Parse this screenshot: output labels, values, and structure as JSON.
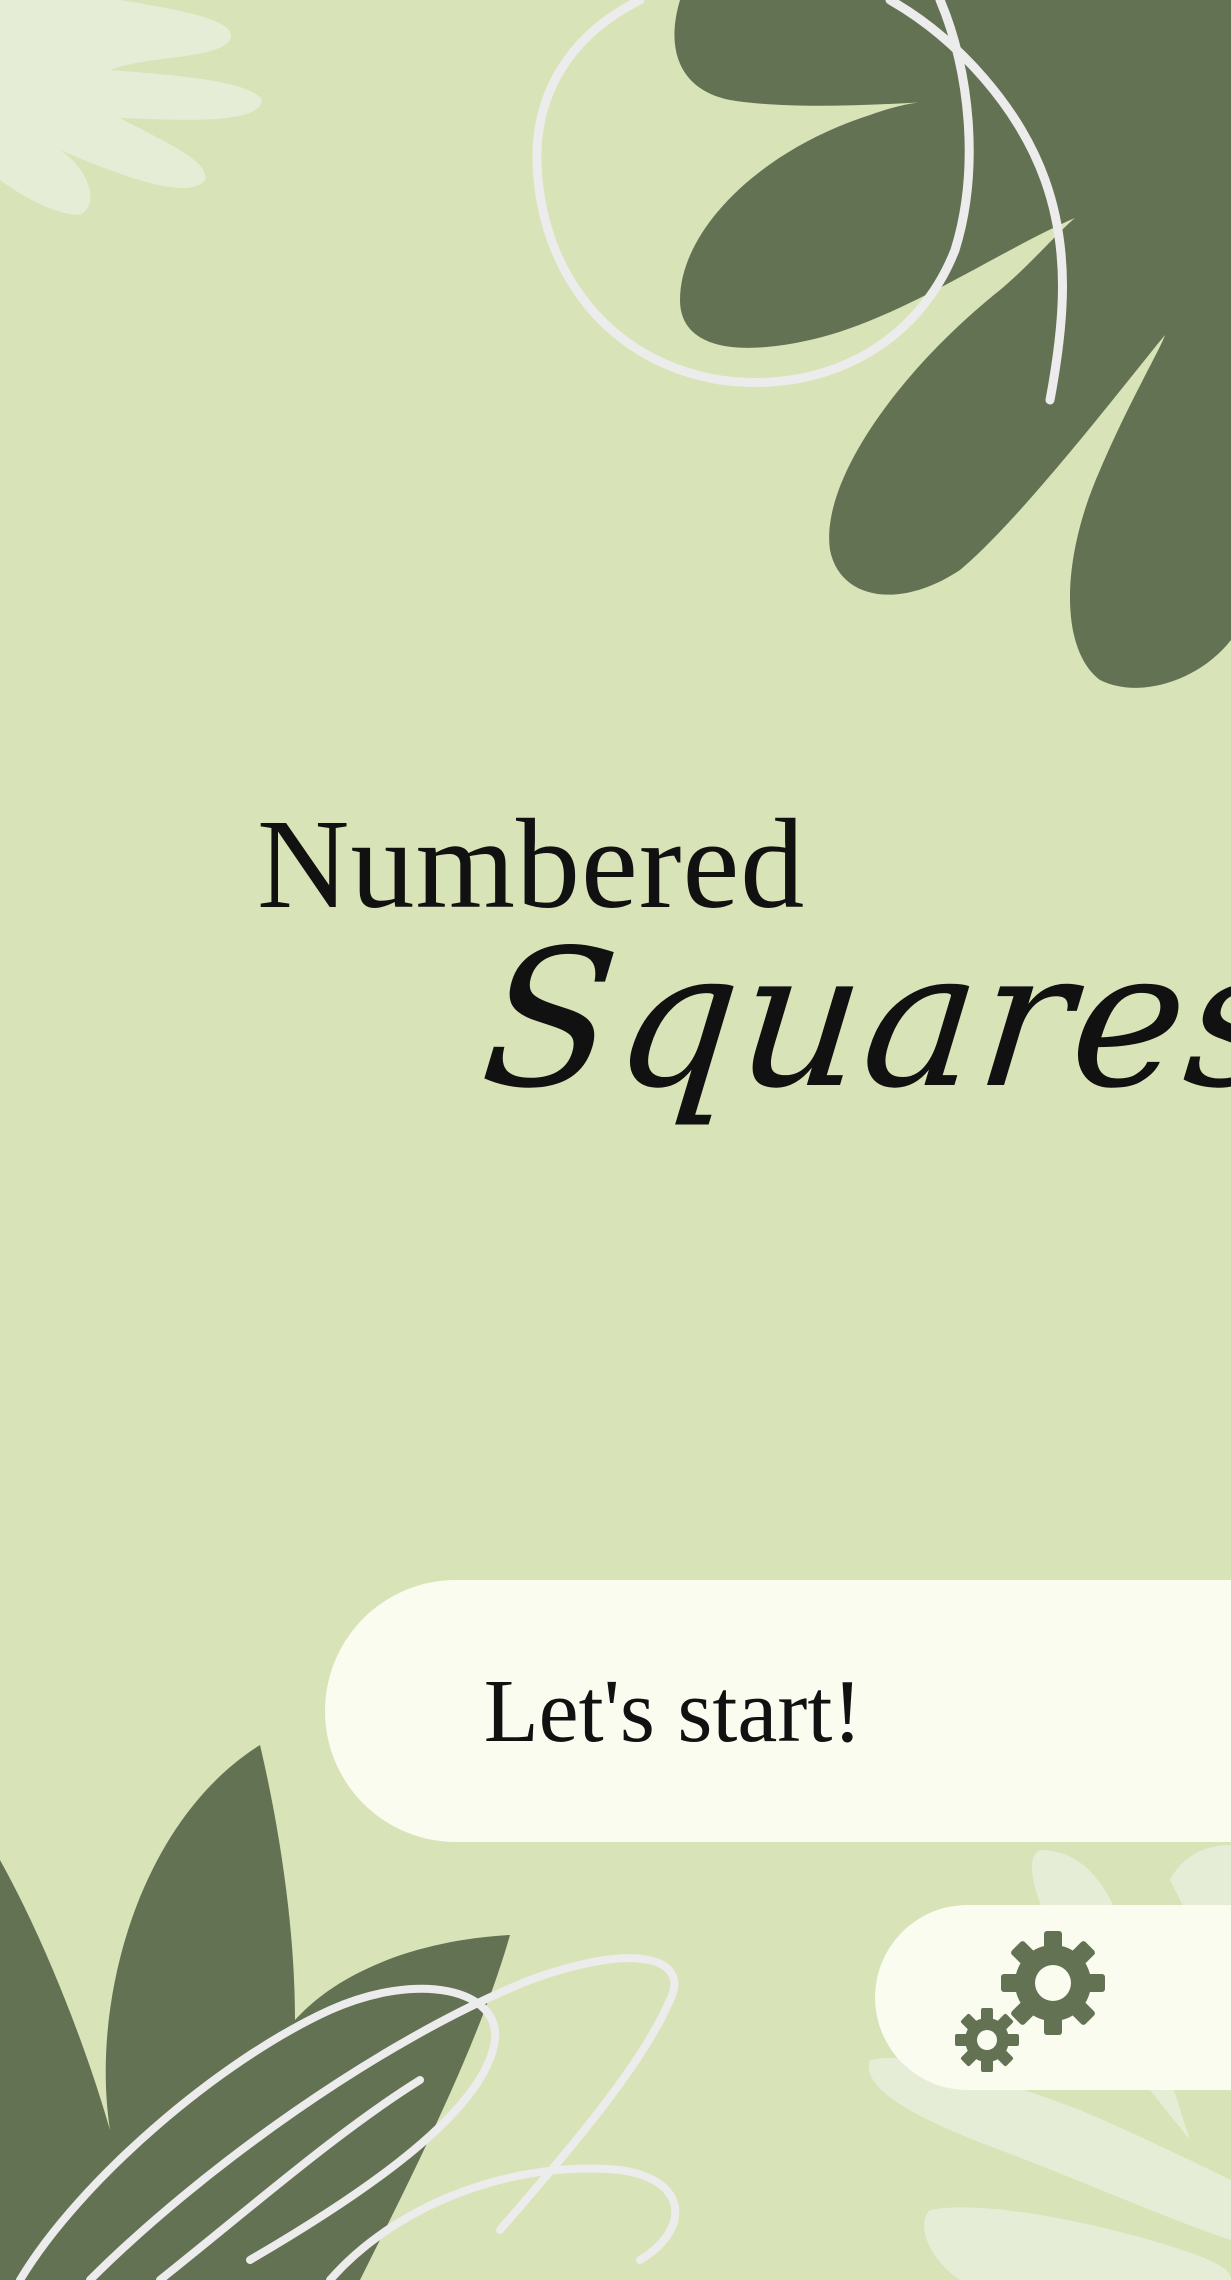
{
  "title": {
    "line1": "Numbered",
    "line2": "Squares"
  },
  "buttons": {
    "start_label": "Let's start!",
    "settings_icon": "gears-icon"
  },
  "colors": {
    "background": "#d8e3b8",
    "leaf_dark": "#647254",
    "leaf_light": "#e6edd6",
    "button_bg": "#f9fcef",
    "text": "#111111",
    "scribble": "#ececec"
  }
}
